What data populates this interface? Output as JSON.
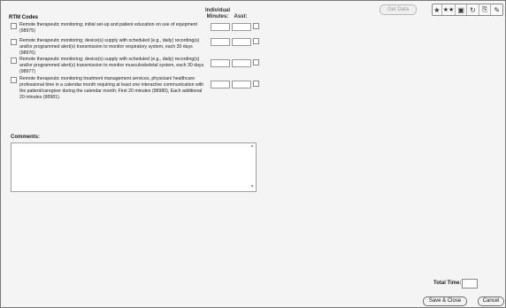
{
  "toolbar": {
    "get_data": "Get Data",
    "icons": [
      "star-icon",
      "stars-icon",
      "save-icon",
      "refresh-icon",
      "copy-icon",
      "edit-icon"
    ],
    "glyphs": [
      "★",
      "★★",
      "▣",
      "↻",
      "⎘",
      "✎"
    ]
  },
  "rtm": {
    "title": "RTM Codes",
    "col_minutes": "Individual Minutes:",
    "col_asst": "Asst:",
    "rows": [
      {
        "label": "Remote therapeutic monitoring; initial set-up and patient education on use of equipment (98975)"
      },
      {
        "label": "Remote therapeutic monitoring; device(s) supply with scheduled (e.g., daily) recording(s) and/or programmed alert(s) transmission to monitor respiratory system, each 30 days (98976)"
      },
      {
        "label": "Remote therapeutic monitoring; device(s) supply with scheduled (e.g., daily) recording(s) and/or programmed alert(s) transmission to monitor musculoskeletal system, each 30 days (98977)"
      },
      {
        "label": "Remote therapeutic monitoring treatment management services, physician/ healthcare professional time in a calendar month requiring at least one interactive communication with the patient/caregiver during the calendar month; First 20 minutes (98980), Each additional 20 minutes (98981)."
      }
    ]
  },
  "comments": {
    "label": "Comments:",
    "value": ""
  },
  "total": {
    "label": "Total Time:",
    "value": ""
  },
  "buttons": {
    "save_close": "Save & Close",
    "cancel": "Cancel"
  }
}
